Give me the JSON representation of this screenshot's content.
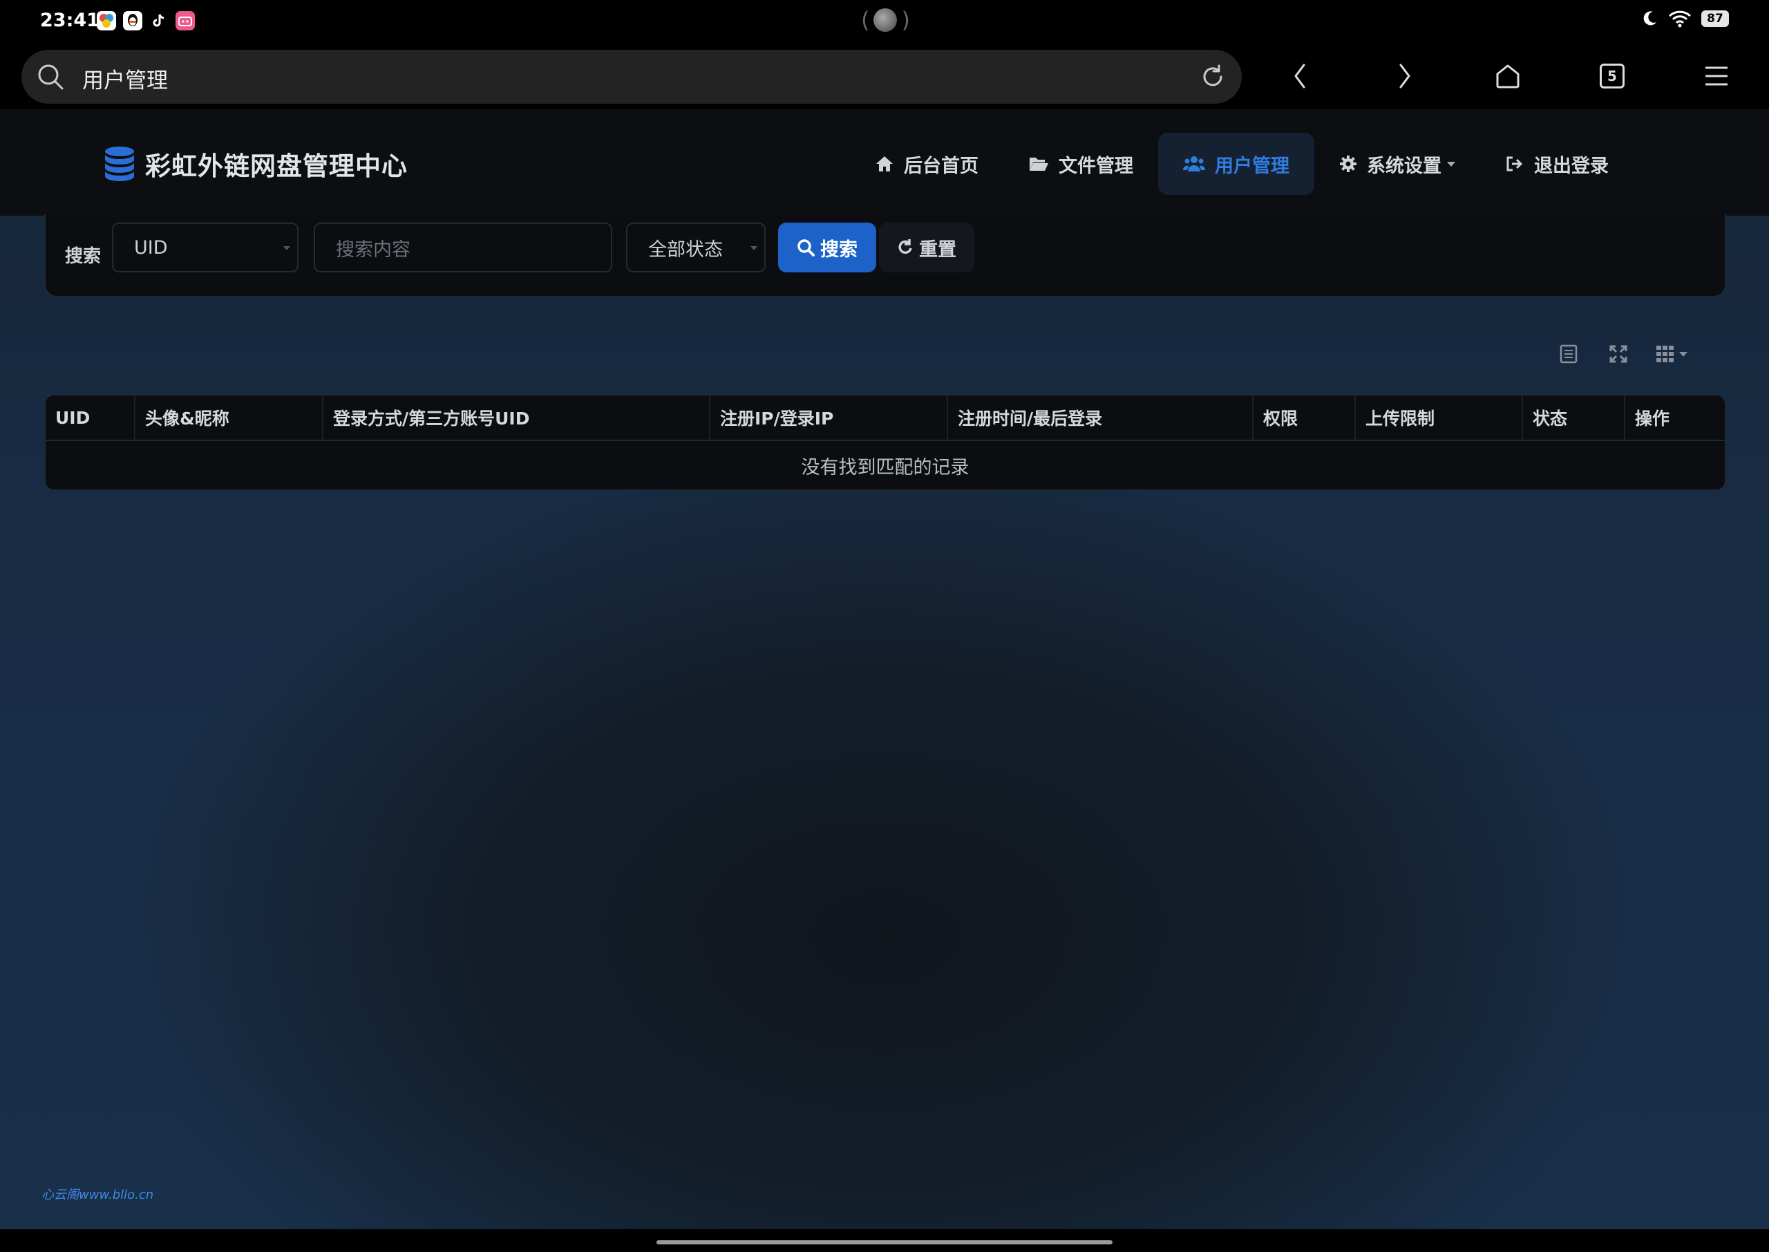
{
  "status_bar": {
    "time": "23:41",
    "apps": [
      {
        "icon": "colorful-app-icon",
        "color": "#ffffff"
      },
      {
        "icon": "qq-icon",
        "color": "#ffffff"
      },
      {
        "icon": "tiktok-icon",
        "color": "#000000"
      },
      {
        "icon": "bilibili-style-icon",
        "color": "#f0598a"
      }
    ],
    "battery": "87",
    "icons": [
      "moon-icon",
      "wifi-icon",
      "battery-icon"
    ]
  },
  "browser": {
    "address_text": "用户管理",
    "tab_count": "5",
    "icons": [
      "search-icon",
      "reload-icon",
      "back-icon",
      "forward-icon",
      "home-icon",
      "tabs-icon",
      "menu-icon"
    ]
  },
  "app": {
    "brand_title": "彩虹外链网盘管理中心",
    "nav": [
      {
        "label": "后台首页",
        "icon": "home-icon",
        "active": false
      },
      {
        "label": "文件管理",
        "icon": "folder-open-icon",
        "active": false
      },
      {
        "label": "用户管理",
        "icon": "users-icon",
        "active": true
      },
      {
        "label": "系统设置",
        "icon": "gear-icon",
        "active": false,
        "dropdown": true
      },
      {
        "label": "退出登录",
        "icon": "sign-out-icon",
        "active": false
      }
    ],
    "accent_color": "#2f7de0"
  },
  "search": {
    "label": "搜索",
    "field_select_value": "UID",
    "content_placeholder": "搜索内容",
    "status_select_value": "全部状态",
    "search_button": "搜索",
    "reset_button": "重置"
  },
  "table": {
    "toolbar_icons": [
      "list-view-icon",
      "fullscreen-icon",
      "columns-grid-icon"
    ],
    "columns": [
      "UID",
      "头像&昵称",
      "登录方式/第三方账号UID",
      "注册IP/登录IP",
      "注册时间/最后登录",
      "权限",
      "上传限制",
      "状态",
      "操作"
    ],
    "empty_text": "没有找到匹配的记录"
  },
  "watermark": "心云阁www.bllo.cn"
}
